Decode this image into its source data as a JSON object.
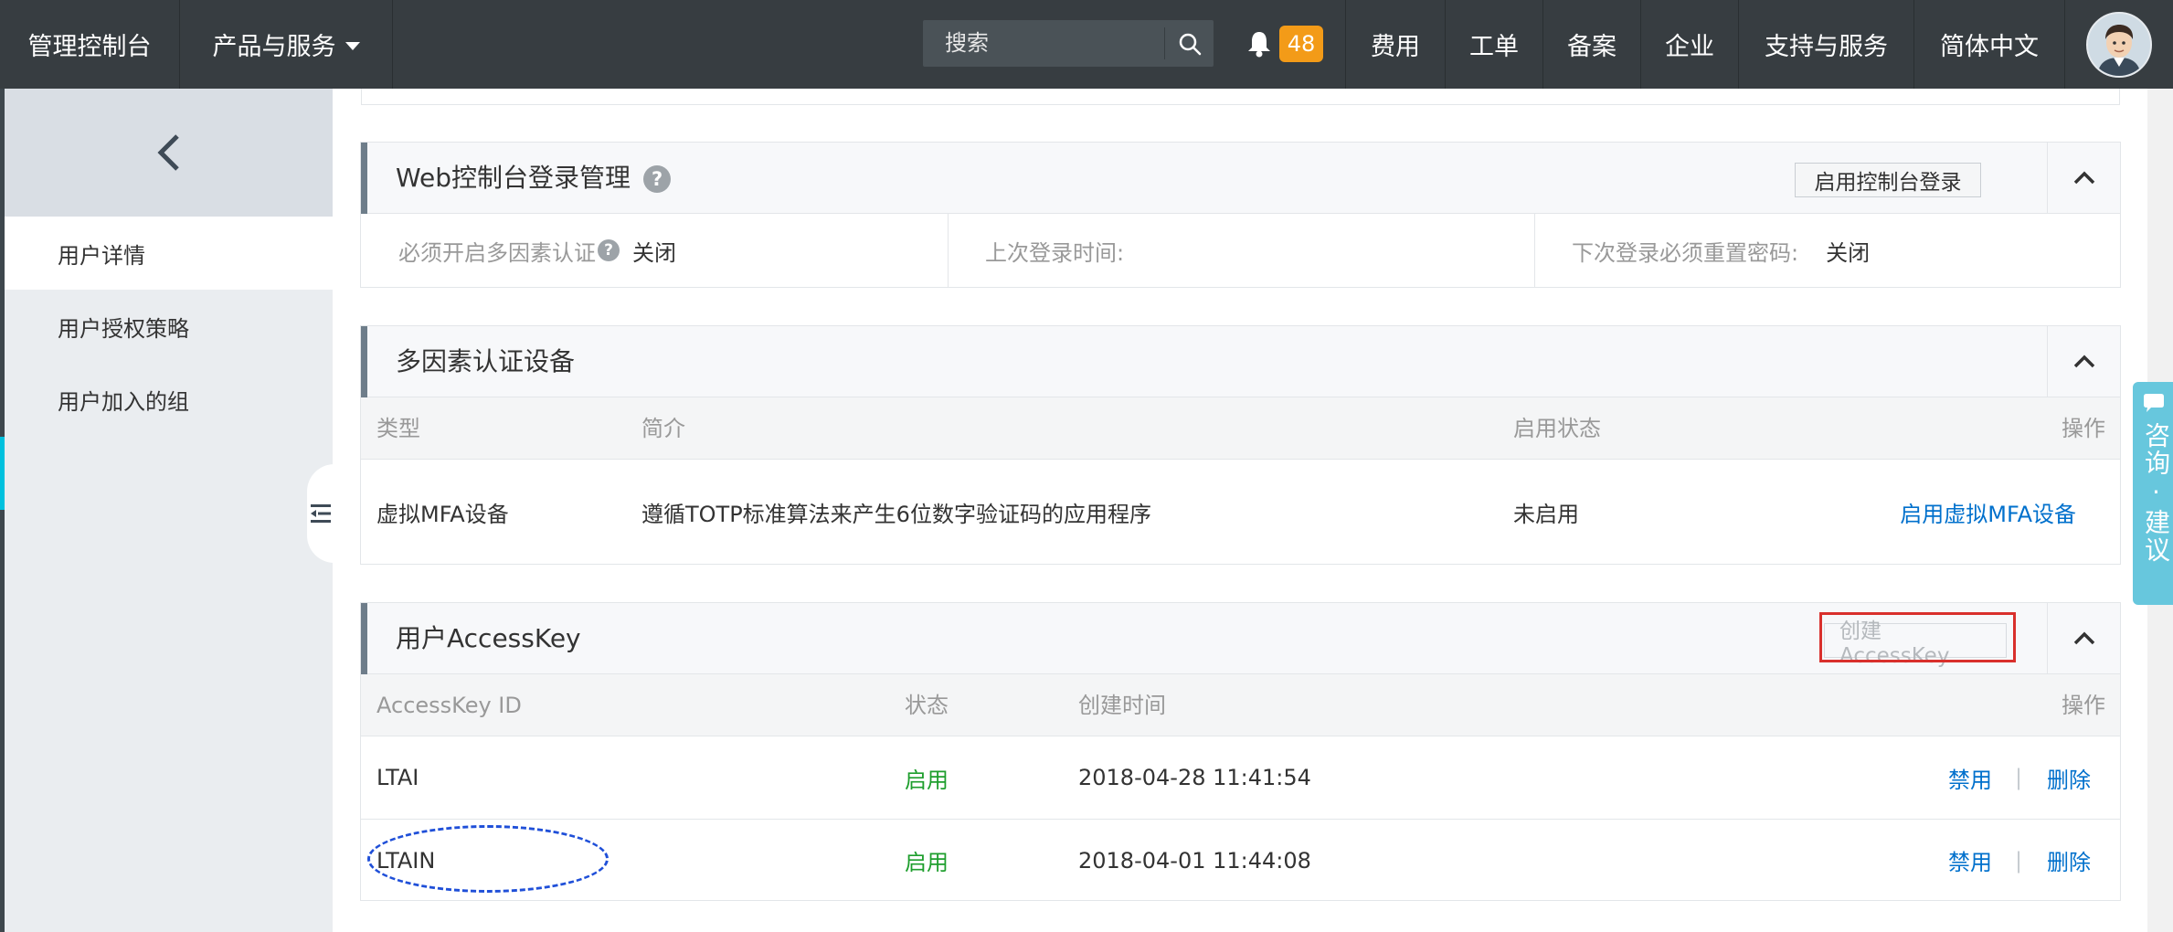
{
  "topbar": {
    "brand": "管理控制台",
    "products": "产品与服务",
    "search_placeholder": "搜索",
    "notification_count": "48",
    "nav": [
      "费用",
      "工单",
      "备案",
      "企业",
      "支持与服务",
      "简体中文"
    ]
  },
  "sidebar": {
    "items": [
      "用户详情",
      "用户授权策略",
      "用户加入的组"
    ],
    "active": "用户详情"
  },
  "web_console": {
    "title": "Web控制台登录管理",
    "enable_button": "启用控制台登录",
    "mfa_required_label": "必须开启多因素认证",
    "mfa_required_value": "关闭",
    "last_login_label": "上次登录时间:",
    "last_login_value": "",
    "reset_pwd_label": "下次登录必须重置密码:",
    "reset_pwd_value": "关闭"
  },
  "mfa": {
    "title": "多因素认证设备",
    "columns": [
      "类型",
      "简介",
      "启用状态",
      "操作"
    ],
    "rows": [
      {
        "type": "虚拟MFA设备",
        "desc": "遵循TOTP标准算法来产生6位数字验证码的应用程序",
        "status": "未启用",
        "action": "启用虚拟MFA设备"
      }
    ]
  },
  "accesskey": {
    "title": "用户AccessKey",
    "create_button": "创建AccessKey",
    "columns": [
      "AccessKey ID",
      "状态",
      "创建时间",
      "操作"
    ],
    "rows": [
      {
        "id": "LTAI",
        "status": "启用",
        "created": "2018-04-28 11:41:54",
        "disable": "禁用",
        "sep": "|",
        "delete": "删除"
      },
      {
        "id": "LTAIN",
        "status": "启用",
        "created": "2018-04-01 11:44:08",
        "disable": "禁用",
        "sep": "|",
        "delete": "删除"
      }
    ]
  },
  "side_tab": {
    "label": "咨询·建议"
  },
  "colors": {
    "topbar": "#373d41",
    "link": "#0070cc",
    "enabled": "#1e9e2d",
    "badge": "#f39b18",
    "side_tab": "#67c7dd",
    "highlight_box": "#d9302c",
    "annotation": "#1f4fd8"
  }
}
